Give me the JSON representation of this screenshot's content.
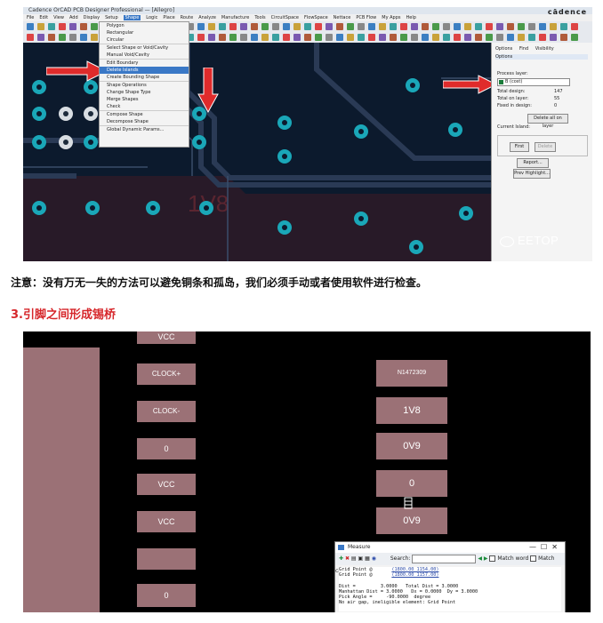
{
  "top_screenshot": {
    "title": "Cadence OrCAD PCB Designer Professional — [Allegro]",
    "brand": "cādence",
    "menu": [
      "File",
      "Edit",
      "View",
      "Add",
      "Display",
      "Setup",
      "Shape",
      "Logic",
      "Place",
      "Route",
      "Analyze",
      "Manufacture",
      "Tools",
      "CircuitSpace",
      "FlowSpace",
      "Nettace",
      "PCB Flow",
      "My Apps",
      "Help"
    ],
    "active_menu": "Shape",
    "shape_menu": [
      "Polygon",
      "Rectangular",
      "Circular",
      "Select Shape or Void/Cavity",
      "Manual Void/Cavity",
      "Edit Boundary",
      "Delete Islands",
      "Create Bounding Shape",
      "Shape Operations",
      "Change Shape Type",
      "Merge Shapes",
      "Check",
      "Compose Shape",
      "Decompose Shape",
      "Global Dynamic Params..."
    ],
    "highlighted_item": "Delete Islands",
    "board_label": "1V8",
    "panel": {
      "tabs": [
        "Options",
        "Find",
        "Visibility"
      ],
      "header": "Options",
      "process_layer_label": "Process layer:",
      "layer_value": "B (cost)",
      "total_design_label": "Total design:",
      "total_design_value": "147",
      "total_on_layer_label": "Total on layer:",
      "total_on_layer_value": "55",
      "fixed_in_design_label": "Fixed in design:",
      "fixed_in_design_value": "0",
      "delete_all_btn": "Delete all on layer",
      "current_island_label": "Current Island:",
      "first_label": "First",
      "delete_btn": "Delete",
      "report_btn": "Report...",
      "prev_highlight_btn": "Prev Highlight..."
    },
    "colors": {
      "board_bg": "#0c1a2d",
      "trace": "#25334a",
      "via": "#1aa7b8",
      "copper": "#3a1f2c",
      "arrow": "#e02b2b"
    }
  },
  "note": "注意：没有万无一失的方法可以避免铜条和孤岛，我们必须手动或者使用软件进行检查。",
  "section_heading": "3.引脚之间形成锡桥",
  "bottom_screenshot": {
    "pads_left": [
      "VCC",
      "CLOCK+",
      "CLOCK-",
      "0",
      "VCC",
      "VCC",
      "",
      "0"
    ],
    "pads_right": [
      "N1472309",
      "1V8",
      "0V9",
      "0",
      "0V9"
    ],
    "measure": {
      "title": "Measure",
      "search_label": "Search:",
      "match_word": "Match word",
      "match_case": "Match case",
      "lines": [
        {
          "label": "Grid Point @",
          "value": "(1800.00 1154.00)"
        },
        {
          "label": "Grid Point @",
          "value": "(1800.00 1157.00)"
        }
      ],
      "dist_line": "Dist =         3.0000   Total Dist = 3.0000",
      "manhattan_line": "Manhattan Dist = 3.0000   Dx = 0.0000  Dy = 3.0000",
      "pick_line": "Pick Angle =     -90.0000  degree",
      "air_line": "No air gap, ineligible element: Grid Point"
    },
    "colors": {
      "bg": "#000000",
      "pad": "#9b7176"
    }
  },
  "watermark": "EETOP"
}
